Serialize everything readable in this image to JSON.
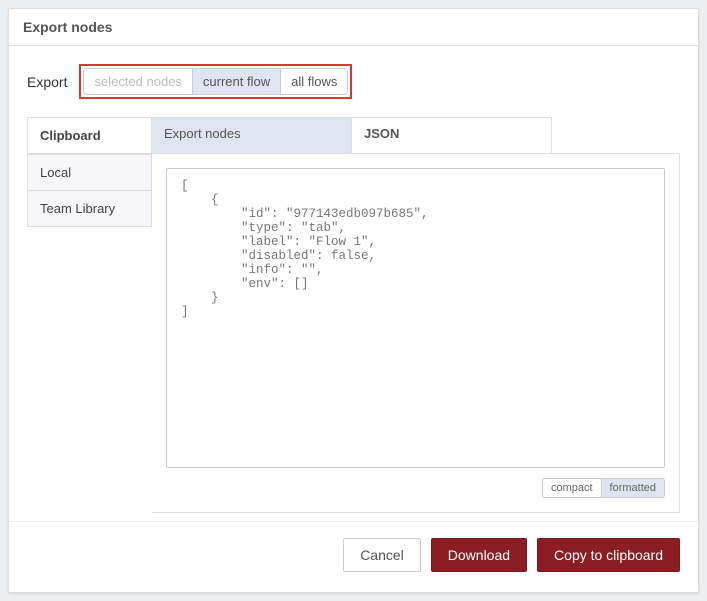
{
  "dialog": {
    "title": "Export nodes"
  },
  "export": {
    "label": "Export",
    "options": {
      "selected_nodes": "selected nodes",
      "current_flow": "current flow",
      "all_flows": "all flows"
    }
  },
  "sidebar": {
    "clipboard": "Clipboard",
    "local": "Local",
    "team_library": "Team Library"
  },
  "tabs": {
    "export_nodes": "Export nodes",
    "json": "JSON"
  },
  "json_text": "[\n    {\n        \"id\": \"977143edb097b685\",\n        \"type\": \"tab\",\n        \"label\": \"Flow 1\",\n        \"disabled\": false,\n        \"info\": \"\",\n        \"env\": []\n    }\n]",
  "format": {
    "compact": "compact",
    "formatted": "formatted"
  },
  "footer": {
    "cancel": "Cancel",
    "download": "Download",
    "copy": "Copy to clipboard"
  }
}
